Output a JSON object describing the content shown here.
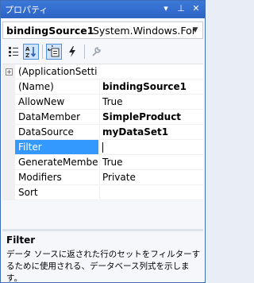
{
  "window": {
    "title": "プロパティ",
    "buttons": [
      "▾",
      "⊥",
      "✕"
    ]
  },
  "selector": {
    "object_name": "bindingSource1",
    "object_type": "System.Windows.For"
  },
  "toolbar": {
    "buttons": [
      "categorized-icon",
      "alphabetical-icon",
      "properties-icon",
      "events-icon",
      "property-pages-icon"
    ]
  },
  "grid": {
    "category_label": "(ApplicationSetti",
    "rows": [
      {
        "name": "(Name)",
        "value": "bindingSource1",
        "bold": true
      },
      {
        "name": "AllowNew",
        "value": "True",
        "bold": false
      },
      {
        "name": "DataMember",
        "value": "SimpleProduct",
        "bold": true
      },
      {
        "name": "DataSource",
        "value": "myDataSet1",
        "bold": true
      },
      {
        "name": "Filter",
        "value": "",
        "bold": false,
        "selected": true
      },
      {
        "name": "GenerateMembe",
        "value": "True",
        "bold": false
      },
      {
        "name": "Modifiers",
        "value": "Private",
        "bold": false
      },
      {
        "name": "Sort",
        "value": "",
        "bold": false
      }
    ]
  },
  "help": {
    "title": "Filter",
    "description": "データ ソースに返された行のセットをフィルターするために使用される、データベース列式を示します。"
  },
  "colors": {
    "titlebar": "#2e64c4",
    "selection": "#3399ff",
    "frame": "#3f6db8"
  }
}
